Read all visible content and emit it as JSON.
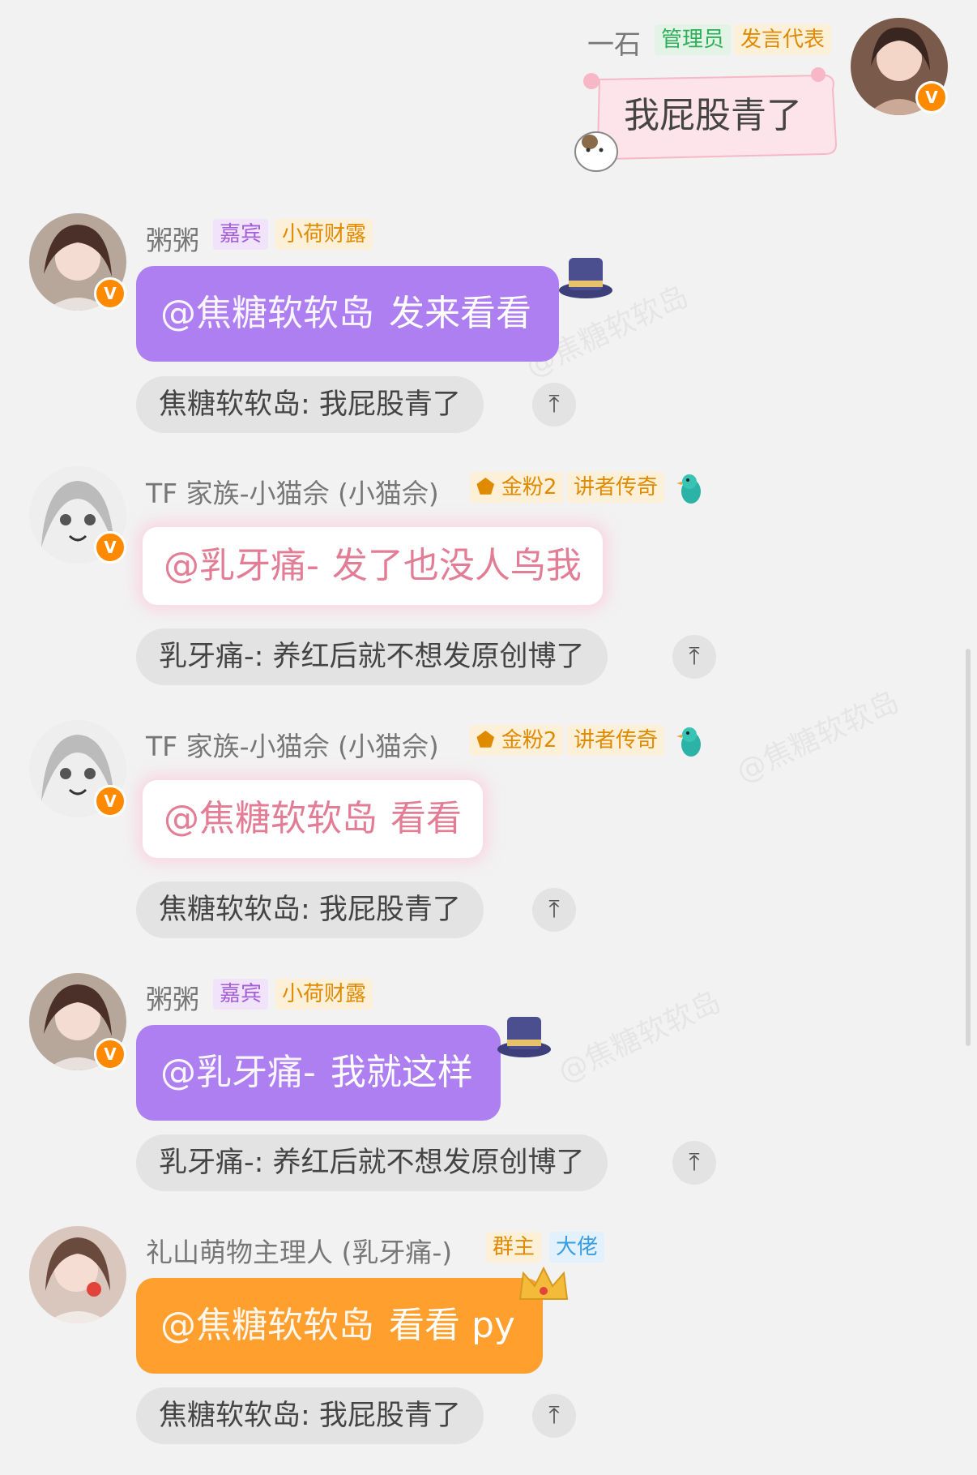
{
  "messages": [
    {
      "sender": "一石",
      "tags": [
        "管理员",
        "发言代表"
      ],
      "text": "我屁股青了"
    },
    {
      "sender": "粥粥",
      "tags": [
        "嘉宾",
        "小荷财露"
      ],
      "mention": "@焦糖软软岛",
      "text": "发来看看",
      "quote": "焦糖软软岛: 我屁股青了"
    },
    {
      "sender": "TF 家族-小猫佘 (小猫佘)",
      "tags": [
        "金粉2",
        "讲者传奇"
      ],
      "mention": "@乳牙痛-",
      "text": "发了也没人鸟我",
      "quote": "乳牙痛-: 养红后就不想发原创博了"
    },
    {
      "sender": "TF 家族-小猫佘 (小猫佘)",
      "tags": [
        "金粉2",
        "讲者传奇"
      ],
      "mention": "@焦糖软软岛",
      "text": "看看",
      "quote": "焦糖软软岛: 我屁股青了"
    },
    {
      "sender": "粥粥",
      "tags": [
        "嘉宾",
        "小荷财露"
      ],
      "mention": "@乳牙痛-",
      "text": "我就这样",
      "quote": "乳牙痛-: 养红后就不想发原创博了"
    },
    {
      "sender": "礼山萌物主理人 (乳牙痛-)",
      "tags": [
        "群主",
        "大佬"
      ],
      "mention": "@焦糖软软岛",
      "text": "看看 py",
      "quote": "焦糖软软岛: 我屁股青了"
    }
  ],
  "icons": {
    "verified": "v-badge-icon",
    "jump": "arrow-up-to-top-icon"
  },
  "colors": {
    "purple_bubble": "#ad7ff0",
    "orange_bubble": "#ff9f2e",
    "background": "#f2f2f2"
  }
}
